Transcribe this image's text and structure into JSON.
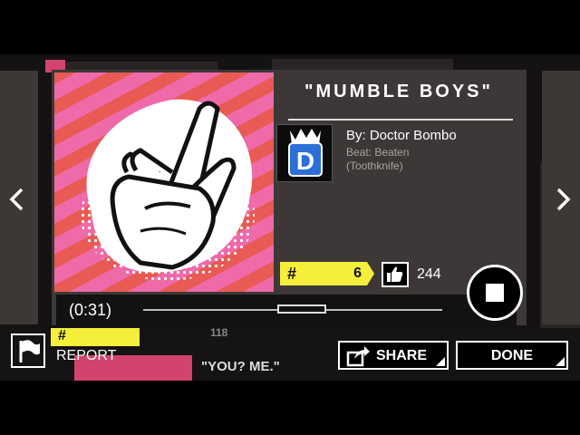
{
  "song": {
    "title": "\"MUMBLE  BOYS\"",
    "artist": "By: Doctor Bombo",
    "beat": "Beat: Beaten (Toothknife)",
    "rank_symbol": "#",
    "rank": "6",
    "likes": "244",
    "avatar_letter": "D"
  },
  "player": {
    "time": "(0:31)",
    "progress": 0.53
  },
  "actions": {
    "report": "REPORT",
    "share": "SHARE",
    "done": "DONE"
  },
  "background": {
    "snippet_likes": "118",
    "snippet_quote": "\"YOU? ME.\"",
    "snippet_hash": "#"
  },
  "colors": {
    "accent_yellow": "#f5ee3b",
    "accent_pink": "#d2436d",
    "stripe_pink": "#ee6aa8",
    "stripe_red": "#e85a53"
  }
}
